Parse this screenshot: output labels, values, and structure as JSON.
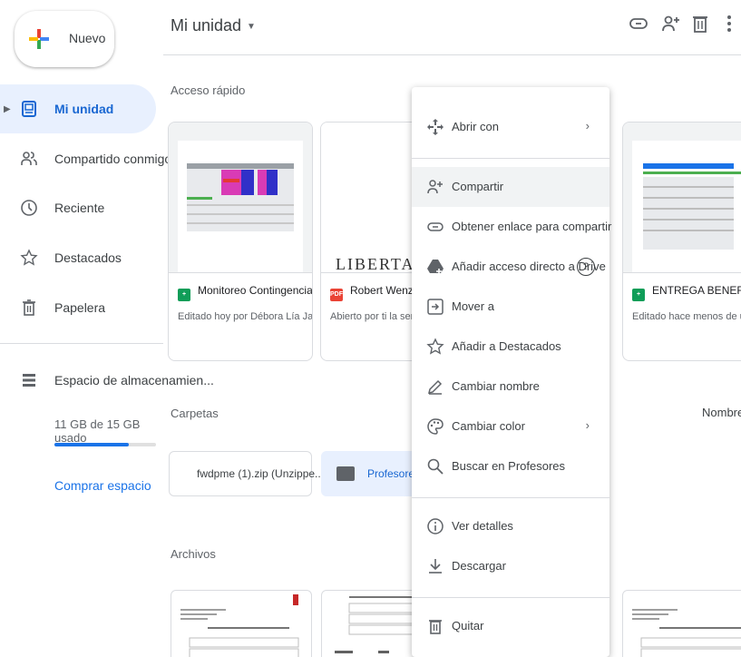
{
  "sidebar": {
    "new_label": "Nuevo",
    "items": [
      {
        "label": "Mi unidad",
        "icon": "drive-icon",
        "active": true
      },
      {
        "label": "Compartido conmigo",
        "icon": "people-icon"
      },
      {
        "label": "Reciente",
        "icon": "clock-icon"
      },
      {
        "label": "Destacados",
        "icon": "star-icon"
      },
      {
        "label": "Papelera",
        "icon": "trash-icon"
      }
    ],
    "storage_label": "Espacio de almacenamien...",
    "storage_used": "11 GB de 15 GB usado",
    "storage_fraction": 0.73,
    "buy_label": "Comprar espacio"
  },
  "header": {
    "title": "Mi unidad"
  },
  "quick_access": {
    "label": "Acceso rápido",
    "cards": [
      {
        "title": "Monitoreo Contingencia CO...",
        "subtitle": "Editado hoy por Débora Lía Jara Va...",
        "type": "sheets"
      },
      {
        "title": "Robert Wenzel_ He",
        "subtitle": "Abierto por ti la semana",
        "type": "pdf",
        "thumb_text": "LIBERTAD"
      },
      {
        "title": "ENTREGA BENEFICIOS T",
        "subtitle": "Editado hace menos de una sem",
        "type": "sheets"
      }
    ]
  },
  "folders": {
    "label": "Carpetas",
    "sort_label": "Nombre",
    "items": [
      {
        "label": "fwdpme (1).zip (Unzippe..."
      },
      {
        "label": "Profesores",
        "selected": true
      }
    ]
  },
  "files": {
    "label": "Archivos"
  },
  "context_menu": {
    "items": [
      {
        "label": "Abrir con",
        "icon": "open-with-icon",
        "submenu": true
      },
      {
        "label": "Compartir",
        "icon": "add-person-icon",
        "highlight": true
      },
      {
        "label": "Obtener enlace para compartir",
        "icon": "link-icon"
      },
      {
        "label": "Añadir acceso directo a Drive",
        "icon": "drive-shortcut-icon",
        "help": "?"
      },
      {
        "label": "Mover a",
        "icon": "move-icon"
      },
      {
        "label": "Añadir a Destacados",
        "icon": "star-icon"
      },
      {
        "label": "Cambiar nombre",
        "icon": "pencil-icon"
      },
      {
        "label": "Cambiar color",
        "icon": "palette-icon",
        "submenu": true
      },
      {
        "label": "Buscar en Profesores",
        "icon": "search-icon"
      },
      {
        "label": "Ver detalles",
        "icon": "info-icon"
      },
      {
        "label": "Descargar",
        "icon": "download-icon"
      },
      {
        "label": "Quitar",
        "icon": "trash-icon"
      }
    ],
    "chevron": "›"
  },
  "colors": {
    "accent": "#1a73e8",
    "active_bg": "#e8f0fe",
    "border": "#f4c52a"
  }
}
